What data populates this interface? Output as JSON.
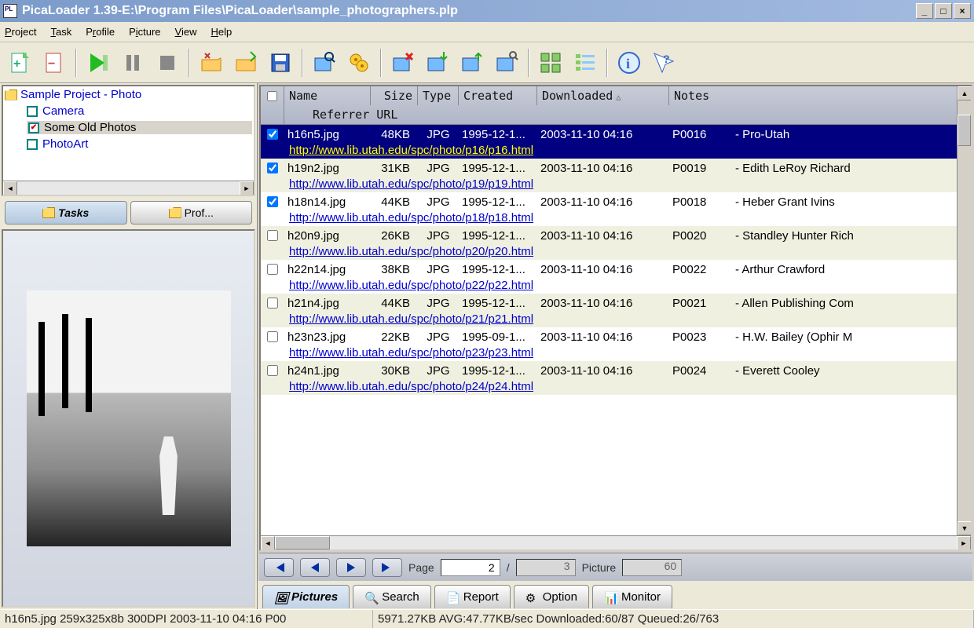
{
  "title": "PicaLoader 1.39-E:\\Program Files\\PicaLoader\\sample_photographers.plp",
  "menu": [
    "Project",
    "Task",
    "Profile",
    "Picture",
    "View",
    "Help"
  ],
  "tree": {
    "root": "Sample Project - Photo",
    "items": [
      {
        "label": "Camera",
        "checked": false
      },
      {
        "label": "Some Old Photos",
        "checked": true,
        "selected": true
      },
      {
        "label": "PhotoArt",
        "checked": false
      }
    ]
  },
  "side_tabs": {
    "tasks": "Tasks",
    "profiles": "Prof..."
  },
  "columns": {
    "name": "Name",
    "size": "Size",
    "type": "Type",
    "created": "Created",
    "downloaded": "Downloaded",
    "notes": "Notes",
    "referrer": "Referrer URL"
  },
  "rows": [
    {
      "checked": true,
      "selected": true,
      "alt": false,
      "name": "h16n5.jpg",
      "size": "48KB",
      "type": "JPG",
      "created": "1995-12-1...",
      "downloaded": "2003-11-10 04:16",
      "id": "P0016",
      "notes": "- Pro-Utah",
      "url": "http://www.lib.utah.edu/spc/photo/p16/p16.html"
    },
    {
      "checked": true,
      "selected": false,
      "alt": true,
      "name": "h19n2.jpg",
      "size": "31KB",
      "type": "JPG",
      "created": "1995-12-1...",
      "downloaded": "2003-11-10 04:16",
      "id": "P0019",
      "notes": "- Edith LeRoy Richard",
      "url": "http://www.lib.utah.edu/spc/photo/p19/p19.html"
    },
    {
      "checked": true,
      "selected": false,
      "alt": false,
      "name": "h18n14.jpg",
      "size": "44KB",
      "type": "JPG",
      "created": "1995-12-1...",
      "downloaded": "2003-11-10 04:16",
      "id": "P0018",
      "notes": "- Heber Grant Ivins",
      "url": "http://www.lib.utah.edu/spc/photo/p18/p18.html"
    },
    {
      "checked": false,
      "selected": false,
      "alt": true,
      "name": "h20n9.jpg",
      "size": "26KB",
      "type": "JPG",
      "created": "1995-12-1...",
      "downloaded": "2003-11-10 04:16",
      "id": "P0020",
      "notes": "- Standley Hunter Rich",
      "url": "http://www.lib.utah.edu/spc/photo/p20/p20.html"
    },
    {
      "checked": false,
      "selected": false,
      "alt": false,
      "name": "h22n14.jpg",
      "size": "38KB",
      "type": "JPG",
      "created": "1995-12-1...",
      "downloaded": "2003-11-10 04:16",
      "id": "P0022",
      "notes": "- Arthur Crawford",
      "url": "http://www.lib.utah.edu/spc/photo/p22/p22.html"
    },
    {
      "checked": false,
      "selected": false,
      "alt": true,
      "name": "h21n4.jpg",
      "size": "44KB",
      "type": "JPG",
      "created": "1995-12-1...",
      "downloaded": "2003-11-10 04:16",
      "id": "P0021",
      "notes": "- Allen Publishing Com",
      "url": "http://www.lib.utah.edu/spc/photo/p21/p21.html"
    },
    {
      "checked": false,
      "selected": false,
      "alt": false,
      "name": "h23n23.jpg",
      "size": "22KB",
      "type": "JPG",
      "created": "1995-09-1...",
      "downloaded": "2003-11-10 04:16",
      "id": "P0023",
      "notes": "- H.W. Bailey (Ophir M",
      "url": "http://www.lib.utah.edu/spc/photo/p23/p23.html"
    },
    {
      "checked": false,
      "selected": false,
      "alt": true,
      "name": "h24n1.jpg",
      "size": "30KB",
      "type": "JPG",
      "created": "1995-12-1...",
      "downloaded": "2003-11-10 04:16",
      "id": "P0024",
      "notes": "- Everett Cooley",
      "url": "http://www.lib.utah.edu/spc/photo/p24/p24.html"
    }
  ],
  "pager": {
    "page_label": "Page",
    "page": "2",
    "pages": "3",
    "picture_label": "Picture",
    "picture": "60",
    "sep": "/"
  },
  "bottom_tabs": {
    "pictures": "Pictures",
    "search": "Search",
    "report": "Report",
    "option": "Option",
    "monitor": "Monitor"
  },
  "status": {
    "left": "h16n5.jpg 259x325x8b 300DPI 2003-11-10 04:16 P00",
    "right": "5971.27KB AVG:47.77KB/sec Downloaded:60/87 Queued:26/763"
  }
}
